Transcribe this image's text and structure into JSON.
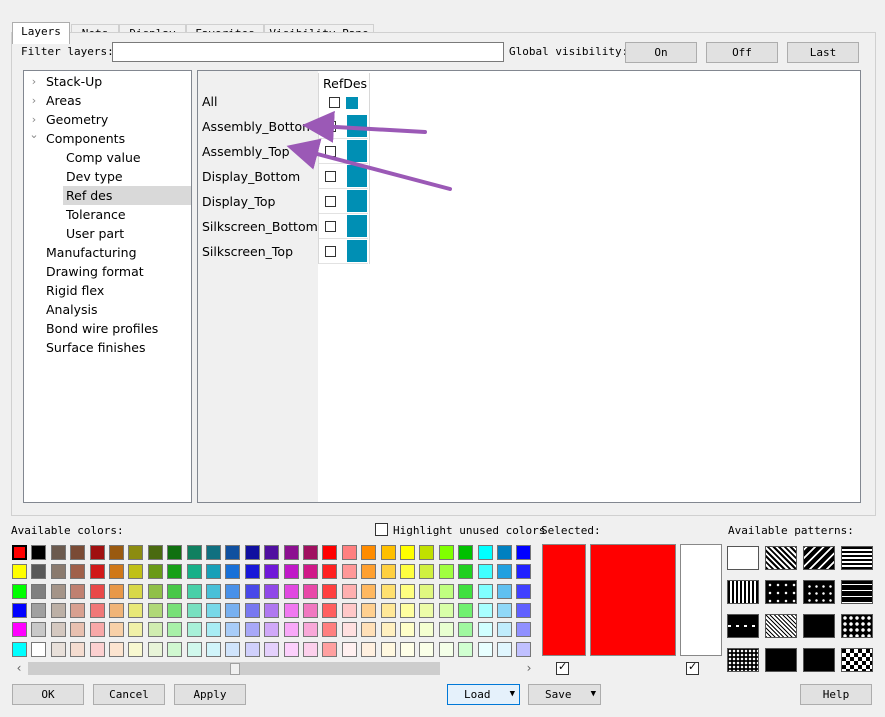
{
  "tabs": [
    {
      "label": "Layers",
      "active": true
    },
    {
      "label": "Nets",
      "active": false
    },
    {
      "label": "Display",
      "active": false
    },
    {
      "label": "Favorites",
      "active": false
    },
    {
      "label": "Visibility Pane",
      "active": false
    }
  ],
  "filter": {
    "label": "Filter layers:",
    "value": "",
    "placeholder": ""
  },
  "global_visibility": {
    "label": "Global visibility:",
    "on_label": "On",
    "off_label": "Off",
    "last_label": "Last"
  },
  "tree": {
    "items": [
      {
        "label": "Stack-Up",
        "level": 0,
        "expander": "collapsed"
      },
      {
        "label": "Areas",
        "level": 0,
        "expander": "collapsed"
      },
      {
        "label": "Geometry",
        "level": 0,
        "expander": "collapsed"
      },
      {
        "label": "Components",
        "level": 0,
        "expander": "expanded"
      },
      {
        "label": "Comp value",
        "level": 1,
        "expander": "none"
      },
      {
        "label": "Dev type",
        "level": 1,
        "expander": "none"
      },
      {
        "label": "Ref des",
        "level": 1,
        "expander": "none",
        "selected": true
      },
      {
        "label": "Tolerance",
        "level": 1,
        "expander": "none"
      },
      {
        "label": "User part",
        "level": 1,
        "expander": "none"
      },
      {
        "label": "Manufacturing",
        "level": 0,
        "expander": "none"
      },
      {
        "label": "Drawing format",
        "level": 0,
        "expander": "none"
      },
      {
        "label": "Rigid flex",
        "level": 0,
        "expander": "none"
      },
      {
        "label": "Analysis",
        "level": 0,
        "expander": "none"
      },
      {
        "label": "Bond wire profiles",
        "level": 0,
        "expander": "none"
      },
      {
        "label": "Surface finishes",
        "level": 0,
        "expander": "none"
      }
    ]
  },
  "layers_table": {
    "column_header": "RefDes",
    "swatch_color": "#008fb4",
    "rows": [
      {
        "label": "All",
        "checked": false
      },
      {
        "label": "Assembly_Bottom",
        "checked": true
      },
      {
        "label": "Assembly_Top",
        "checked": false
      },
      {
        "label": "Display_Bottom",
        "checked": false
      },
      {
        "label": "Display_Top",
        "checked": false
      },
      {
        "label": "Silkscreen_Bottom",
        "checked": false
      },
      {
        "label": "Silkscreen_Top",
        "checked": false
      }
    ]
  },
  "annotations": {
    "arrow_color": "#9b59b6"
  },
  "colors": {
    "label": "Available colors:",
    "highlight_unused_label": "Highlight unused colors",
    "highlight_unused_checked": false,
    "palette": [
      [
        "#ff0000",
        "#000000",
        "#6b5a4e",
        "#7a4b35",
        "#a01010",
        "#9a5a10",
        "#8c8c10",
        "#4a6a10",
        "#107010",
        "#108060",
        "#107080",
        "#1050a0",
        "#1010a0",
        "#5010a0",
        "#8c1090",
        "#a01060",
        "#ff0000",
        "#ff8080",
        "#ff8c00",
        "#ffc000",
        "#ffff00",
        "#c0e000",
        "#80ff00",
        "#00c000",
        "#00ffff",
        "#0080c0",
        "#0000ff"
      ],
      [
        "#ffff00",
        "#595959",
        "#8a7a6e",
        "#a0604a",
        "#d01818",
        "#d07818",
        "#c0c018",
        "#6a9a18",
        "#18a018",
        "#18b088",
        "#18a0b8",
        "#1870d8",
        "#1818d8",
        "#7018d8",
        "#c018c8",
        "#d01888",
        "#ff2020",
        "#ff9898",
        "#ffa030",
        "#ffd040",
        "#ffff40",
        "#d0f040",
        "#a0ff40",
        "#20d020",
        "#40ffff",
        "#20a0e0",
        "#2020ff"
      ],
      [
        "#00ff00",
        "#808080",
        "#a49488",
        "#c08070",
        "#e84848",
        "#e89848",
        "#d8d848",
        "#90c048",
        "#48c848",
        "#48d0a8",
        "#48c0d8",
        "#4890e8",
        "#4848e8",
        "#9048e8",
        "#e048e0",
        "#e848a8",
        "#ff4040",
        "#ffb0b0",
        "#ffb860",
        "#ffe070",
        "#ffff80",
        "#e0f880",
        "#c0ff80",
        "#40e040",
        "#80ffff",
        "#60c0f0",
        "#4040ff"
      ],
      [
        "#0000ff",
        "#a0a0a0",
        "#bcb0a6",
        "#d8a090",
        "#f07878",
        "#f0b478",
        "#e8e878",
        "#b0d878",
        "#78e078",
        "#78e0c0",
        "#78d8e8",
        "#78b0f0",
        "#7878f0",
        "#b078f0",
        "#f078f0",
        "#f078c0",
        "#ff6060",
        "#ffc8c8",
        "#ffd090",
        "#ffe898",
        "#ffffa0",
        "#ecfca8",
        "#d8ffa8",
        "#70f070",
        "#a8ffff",
        "#90d8f8",
        "#6060ff"
      ],
      [
        "#ff00ff",
        "#c8c8c8",
        "#d4c8c0",
        "#e8c0b0",
        "#f8a8a8",
        "#f8d0a8",
        "#f0f0a8",
        "#d0ecb0",
        "#a8f0a8",
        "#a8f0d8",
        "#a8ecf4",
        "#a8ccf8",
        "#a8a8f8",
        "#d0a8f8",
        "#f8a8f8",
        "#f8a8d8",
        "#ff8080",
        "#ffe0e0",
        "#ffe0b8",
        "#fff0c0",
        "#ffffc8",
        "#f4ffd0",
        "#e8ffd0",
        "#a0f8a0",
        "#d0ffff",
        "#c0ecfc",
        "#9090ff"
      ],
      [
        "#00ffff",
        "#ffffff",
        "#e8e0da",
        "#f4dcd0",
        "#fcd0d0",
        "#fce4d0",
        "#f8f8d0",
        "#e8f4d8",
        "#d0f8d0",
        "#d0f8ec",
        "#d0f4fa",
        "#d0e4fc",
        "#d0d0fc",
        "#e4d0fc",
        "#fcd0fc",
        "#fcd0ec",
        "#ffa0a0",
        "#fff0f0",
        "#fff0e0",
        "#fff8e0",
        "#ffffe8",
        "#faffe8",
        "#f4ffe8",
        "#d0ffd0",
        "#e8ffff",
        "#e0f6fe",
        "#c0c0ff"
      ]
    ],
    "selected_cell": {
      "row": 0,
      "col": 0
    }
  },
  "selected": {
    "label": "Selected:",
    "color": "#ff0000",
    "background": "#ffffff",
    "check1": true,
    "check2": true
  },
  "patterns": {
    "label": "Available patterns:",
    "names": [
      "solid-white",
      "diag-fine",
      "diag-wide",
      "horizontal-lines",
      "vertical-lines",
      "dots-sparse",
      "plus-pattern",
      "dashes",
      "dash-row",
      "cross-hatch-diag",
      "grid",
      "diamond-dots",
      "checker-small",
      "diamond-outline",
      "large-cross",
      "checker-large"
    ]
  },
  "buttons": {
    "ok": "OK",
    "cancel": "Cancel",
    "apply": "Apply",
    "load": "Load",
    "save": "Save",
    "help": "Help"
  }
}
